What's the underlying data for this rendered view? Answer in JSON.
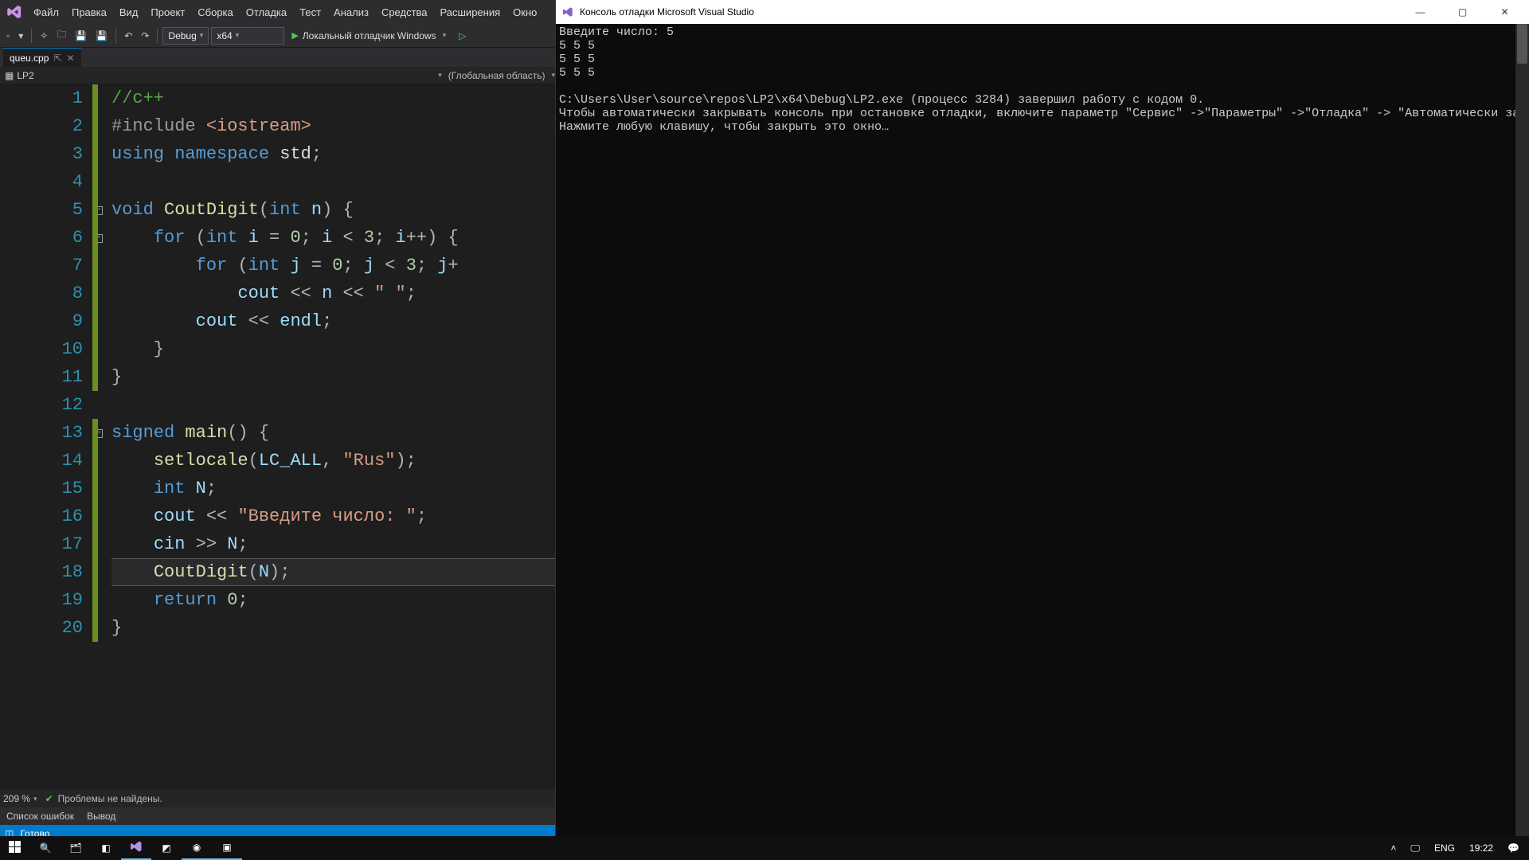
{
  "menubar": [
    "Файл",
    "Правка",
    "Вид",
    "Проект",
    "Сборка",
    "Отладка",
    "Тест",
    "Анализ",
    "Средства",
    "Расширения",
    "Окно"
  ],
  "toolbar": {
    "config": "Debug",
    "platform": "x64",
    "debugger": "Локальный отладчик Windows"
  },
  "tab": {
    "file": "queu.cpp"
  },
  "navbar": {
    "project": "LP2",
    "scope": "(Глобальная область)"
  },
  "status": {
    "zoom": "209 %",
    "issues": "Проблемы не найдены.",
    "outputTabs": [
      "Список ошибок",
      "Вывод"
    ],
    "ready": "Готово"
  },
  "code": {
    "lines": [
      {
        "n": 1,
        "tokens": [
          {
            "t": "//c++",
            "c": "c-comment"
          }
        ]
      },
      {
        "n": 2,
        "tokens": [
          {
            "t": "#include ",
            "c": "c-pp"
          },
          {
            "t": "<iostream>",
            "c": "c-str"
          }
        ]
      },
      {
        "n": 3,
        "tokens": [
          {
            "t": "using namespace ",
            "c": "c-kw"
          },
          {
            "t": "std",
            "c": "c-ns"
          },
          {
            "t": ";",
            "c": "c-op"
          }
        ]
      },
      {
        "n": 4,
        "tokens": []
      },
      {
        "n": 5,
        "fold": true,
        "tokens": [
          {
            "t": "void ",
            "c": "c-type"
          },
          {
            "t": "CoutDigit",
            "c": "c-func"
          },
          {
            "t": "(",
            "c": "c-op"
          },
          {
            "t": "int ",
            "c": "c-type"
          },
          {
            "t": "n",
            "c": "c-id"
          },
          {
            "t": ") {",
            "c": "c-op"
          }
        ]
      },
      {
        "n": 6,
        "fold": true,
        "tokens": [
          {
            "t": "    ",
            "c": ""
          },
          {
            "t": "for ",
            "c": "c-kw"
          },
          {
            "t": "(",
            "c": "c-op"
          },
          {
            "t": "int ",
            "c": "c-type"
          },
          {
            "t": "i",
            "c": "c-id"
          },
          {
            "t": " = ",
            "c": "c-op"
          },
          {
            "t": "0",
            "c": "c-num"
          },
          {
            "t": "; ",
            "c": "c-op"
          },
          {
            "t": "i",
            "c": "c-id"
          },
          {
            "t": " < ",
            "c": "c-op"
          },
          {
            "t": "3",
            "c": "c-num"
          },
          {
            "t": "; ",
            "c": "c-op"
          },
          {
            "t": "i",
            "c": "c-id"
          },
          {
            "t": "++) {",
            "c": "c-op"
          }
        ]
      },
      {
        "n": 7,
        "tokens": [
          {
            "t": "        ",
            "c": ""
          },
          {
            "t": "for ",
            "c": "c-kw"
          },
          {
            "t": "(",
            "c": "c-op"
          },
          {
            "t": "int ",
            "c": "c-type"
          },
          {
            "t": "j",
            "c": "c-id"
          },
          {
            "t": " = ",
            "c": "c-op"
          },
          {
            "t": "0",
            "c": "c-num"
          },
          {
            "t": "; ",
            "c": "c-op"
          },
          {
            "t": "j",
            "c": "c-id"
          },
          {
            "t": " < ",
            "c": "c-op"
          },
          {
            "t": "3",
            "c": "c-num"
          },
          {
            "t": "; ",
            "c": "c-op"
          },
          {
            "t": "j",
            "c": "c-id"
          },
          {
            "t": "+",
            "c": "c-op"
          }
        ]
      },
      {
        "n": 8,
        "tokens": [
          {
            "t": "            ",
            "c": ""
          },
          {
            "t": "cout",
            "c": "c-id"
          },
          {
            "t": " << ",
            "c": "c-op"
          },
          {
            "t": "n",
            "c": "c-id"
          },
          {
            "t": " << ",
            "c": "c-op"
          },
          {
            "t": "\" \"",
            "c": "c-str"
          },
          {
            "t": ";",
            "c": "c-op"
          }
        ]
      },
      {
        "n": 9,
        "tokens": [
          {
            "t": "        ",
            "c": ""
          },
          {
            "t": "cout",
            "c": "c-id"
          },
          {
            "t": " << ",
            "c": "c-op"
          },
          {
            "t": "endl",
            "c": "c-id"
          },
          {
            "t": ";",
            "c": "c-op"
          }
        ]
      },
      {
        "n": 10,
        "tokens": [
          {
            "t": "    }",
            "c": "c-op"
          }
        ]
      },
      {
        "n": 11,
        "tokens": [
          {
            "t": "}",
            "c": "c-op"
          }
        ]
      },
      {
        "n": 12,
        "tokens": []
      },
      {
        "n": 13,
        "fold": true,
        "tokens": [
          {
            "t": "signed ",
            "c": "c-type"
          },
          {
            "t": "main",
            "c": "c-func"
          },
          {
            "t": "() {",
            "c": "c-op"
          }
        ]
      },
      {
        "n": 14,
        "tokens": [
          {
            "t": "    ",
            "c": ""
          },
          {
            "t": "setlocale",
            "c": "c-func"
          },
          {
            "t": "(",
            "c": "c-op"
          },
          {
            "t": "LC_ALL",
            "c": "c-id"
          },
          {
            "t": ", ",
            "c": "c-op"
          },
          {
            "t": "\"Rus\"",
            "c": "c-str"
          },
          {
            "t": ");",
            "c": "c-op"
          }
        ]
      },
      {
        "n": 15,
        "tokens": [
          {
            "t": "    ",
            "c": ""
          },
          {
            "t": "int ",
            "c": "c-type"
          },
          {
            "t": "N",
            "c": "c-id"
          },
          {
            "t": ";",
            "c": "c-op"
          }
        ]
      },
      {
        "n": 16,
        "tokens": [
          {
            "t": "    ",
            "c": ""
          },
          {
            "t": "cout",
            "c": "c-id"
          },
          {
            "t": " << ",
            "c": "c-op"
          },
          {
            "t": "\"Введите число: \"",
            "c": "c-str"
          },
          {
            "t": ";",
            "c": "c-op"
          }
        ]
      },
      {
        "n": 17,
        "tokens": [
          {
            "t": "    ",
            "c": ""
          },
          {
            "t": "cin",
            "c": "c-id"
          },
          {
            "t": " >> ",
            "c": "c-op"
          },
          {
            "t": "N",
            "c": "c-id"
          },
          {
            "t": ";",
            "c": "c-op"
          }
        ]
      },
      {
        "n": 18,
        "hl": true,
        "tokens": [
          {
            "t": "    ",
            "c": ""
          },
          {
            "t": "CoutDigit",
            "c": "c-func"
          },
          {
            "t": "(",
            "c": "c-op"
          },
          {
            "t": "N",
            "c": "c-id"
          },
          {
            "t": ");",
            "c": "c-op"
          }
        ]
      },
      {
        "n": 19,
        "tokens": [
          {
            "t": "    ",
            "c": ""
          },
          {
            "t": "return ",
            "c": "c-kw"
          },
          {
            "t": "0",
            "c": "c-num"
          },
          {
            "t": ";",
            "c": "c-op"
          }
        ]
      },
      {
        "n": 20,
        "tokens": [
          {
            "t": "}",
            "c": "c-op"
          }
        ]
      }
    ]
  },
  "console": {
    "title": "Консоль отладки Microsoft Visual Studio",
    "lines": [
      "Введите число: 5",
      "5 5 5",
      "5 5 5",
      "5 5 5",
      "",
      "C:\\Users\\User\\source\\repos\\LP2\\x64\\Debug\\LP2.exe (процесс 3284) завершил работу с кодом 0.",
      "Чтобы автоматически закрывать консоль при остановке отладки, включите параметр \"Сервис\" ->\"Параметры\" ->\"Отладка\" -> \"Автоматически закрыть консоль при остановке отладки\".",
      "Нажмите любую клавишу, чтобы закрыть это окно…"
    ]
  },
  "taskbar": {
    "tray": {
      "lang": "ENG",
      "time": "19:22"
    }
  }
}
